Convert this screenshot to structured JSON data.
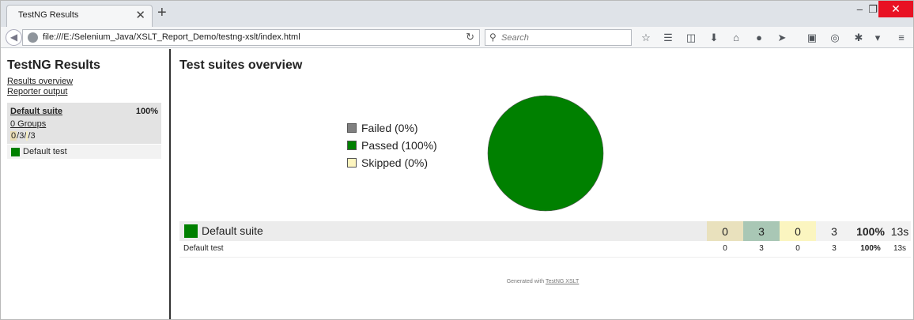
{
  "browser": {
    "tab_title": "TestNG Results",
    "tab_close": "✕",
    "new_tab": "+",
    "url": "file:///E:/Selenium_Java/XSLT_Report_Demo/testng-xslt/index.html",
    "search_placeholder": "Search",
    "window_controls": {
      "minimize": "–",
      "restore": "❐",
      "close": "✕"
    }
  },
  "sidebar": {
    "title": "TestNG Results",
    "links": [
      "Results overview",
      "Reporter output"
    ],
    "suite": {
      "name": "Default suite",
      "percent": "100%",
      "groups": "0 Groups",
      "counts": {
        "failed": "0",
        "sep1": "/",
        "passed": "3",
        "sep2": "/",
        "skipped": "",
        "sep3": "/",
        "total": "3"
      }
    },
    "test_item": "Default test"
  },
  "main": {
    "title": "Test suites overview",
    "legend": [
      {
        "label": "Failed (0%)",
        "color": "#808080"
      },
      {
        "label": "Passed (100%)",
        "color": "#008000"
      },
      {
        "label": "Skipped (0%)",
        "color": "#fdf5bf"
      }
    ],
    "table": {
      "suite_row": {
        "name": "Default suite",
        "failed": "0",
        "passed": "3",
        "skipped": "0",
        "total": "3",
        "percent": "100%",
        "time": "13s"
      },
      "test_row": {
        "name": "Default test",
        "failed": "0",
        "passed": "3",
        "skipped": "0",
        "total": "3",
        "percent": "100%",
        "time": "13s"
      }
    },
    "footer": {
      "prefix": "Generated with",
      "link": "TestNG XSLT"
    }
  },
  "chart_data": {
    "type": "pie",
    "categories": [
      "Failed",
      "Passed",
      "Skipped"
    ],
    "values": [
      0,
      100,
      0
    ],
    "colors": [
      "#808080",
      "#008000",
      "#fdf5bf"
    ],
    "legend_position": "left"
  }
}
